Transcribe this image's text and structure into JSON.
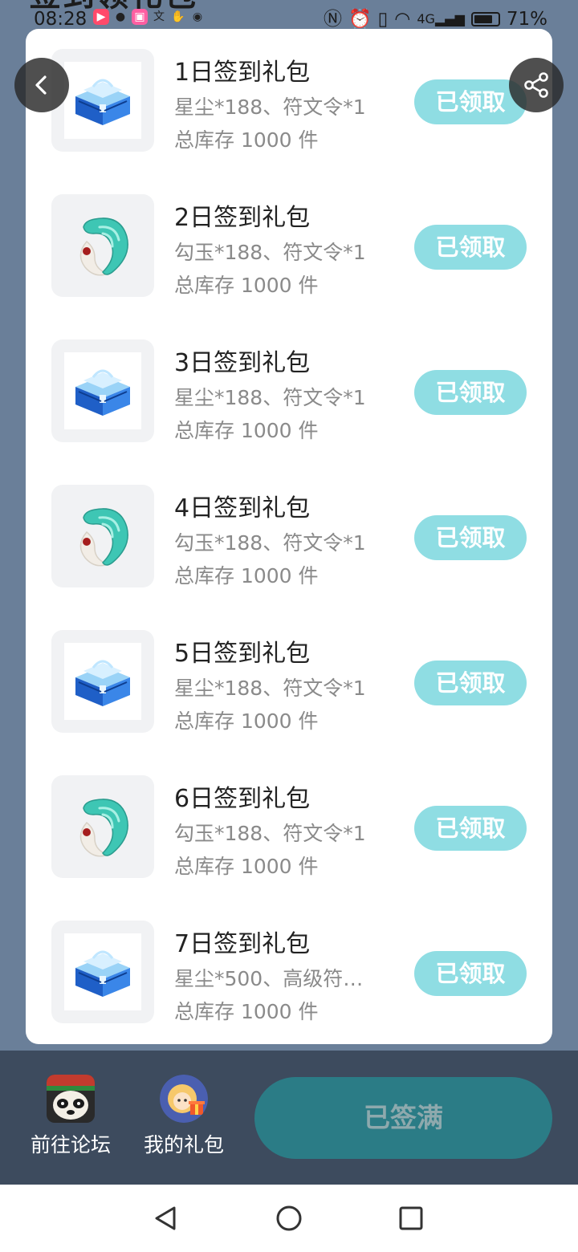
{
  "status_bar": {
    "page_title_partial": "签到领礼包",
    "time": "08:28",
    "battery": "71%",
    "notification_icons": [
      "video-app-icon",
      "message-icon",
      "photo-app-icon",
      "translate-icon",
      "hand-icon",
      "eye-icon"
    ],
    "right_icons": [
      "nfc-icon",
      "alarm-icon",
      "vibrate-icon",
      "wifi-icon",
      "4g-signal-icon",
      "battery-icon"
    ]
  },
  "header": {
    "back_icon": "chevron-left-icon",
    "share_icon": "share-icon"
  },
  "gifts": [
    {
      "title": "1日签到礼包",
      "desc": "星尘*188、符文令*1",
      "stock": "总库存 1000 件",
      "button": "已领取",
      "icon": "crystal-chest-icon"
    },
    {
      "title": "2日签到礼包",
      "desc": "勾玉*188、符文令*1",
      "stock": "总库存 1000 件",
      "button": "已领取",
      "icon": "jade-magatama-icon"
    },
    {
      "title": "3日签到礼包",
      "desc": "星尘*188、符文令*1",
      "stock": "总库存 1000 件",
      "button": "已领取",
      "icon": "crystal-chest-icon"
    },
    {
      "title": "4日签到礼包",
      "desc": "勾玉*188、符文令*1",
      "stock": "总库存 1000 件",
      "button": "已领取",
      "icon": "jade-magatama-icon"
    },
    {
      "title": "5日签到礼包",
      "desc": "星尘*188、符文令*1",
      "stock": "总库存 1000 件",
      "button": "已领取",
      "icon": "crystal-chest-icon"
    },
    {
      "title": "6日签到礼包",
      "desc": "勾玉*188、符文令*1",
      "stock": "总库存 1000 件",
      "button": "已领取",
      "icon": "jade-magatama-icon"
    },
    {
      "title": "7日签到礼包",
      "desc": "星尘*500、高级符…",
      "stock": "总库存 1000 件",
      "button": "已领取",
      "icon": "crystal-chest-icon"
    }
  ],
  "bottom_bar": {
    "forum_label": "前往论坛",
    "forum_icon": "panda-warrior-game-icon",
    "my_gifts_label": "我的礼包",
    "my_gifts_icon": "anime-girl-gift-icon",
    "signed_button": "已签满"
  },
  "system_nav": {
    "back": "triangle-back-icon",
    "home": "circle-home-icon",
    "recents": "square-recents-icon"
  },
  "colors": {
    "claim_button": "#8fdde3",
    "signed_button": "#2b7c86",
    "bottom_bar": "#3d4b5e",
    "backdrop": "#6a7f99"
  }
}
